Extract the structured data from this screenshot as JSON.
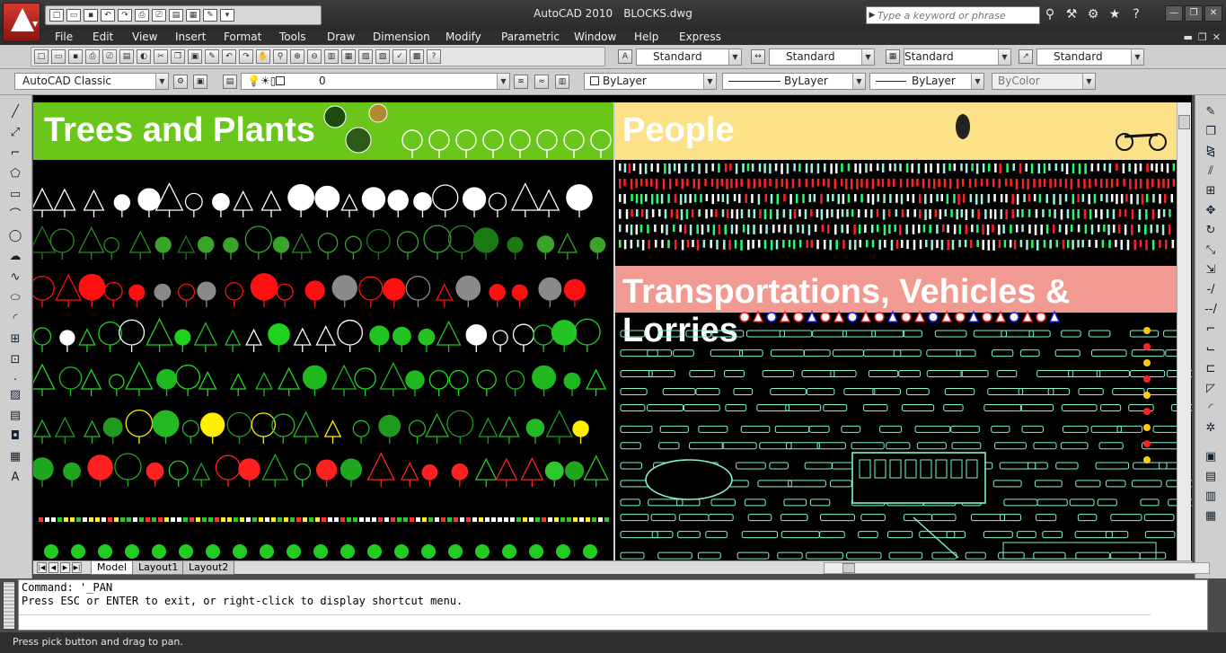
{
  "app": {
    "name": "AutoCAD 2010",
    "document": "BLOCKS.dwg"
  },
  "search": {
    "placeholder": "Type a keyword or phrase"
  },
  "menus": [
    "File",
    "Edit",
    "View",
    "Insert",
    "Format",
    "Tools",
    "Draw",
    "Dimension",
    "Modify",
    "Parametric",
    "Window",
    "Help",
    "Express"
  ],
  "toolbar": {
    "text_style": "Standard",
    "dim_style": "Standard",
    "table_style": "Standard",
    "mleader_style": "Standard",
    "workspace": "AutoCAD Classic",
    "layer": "0",
    "color": "ByLayer",
    "linetype": "ByLayer",
    "lineweight": "ByLayer",
    "plot_style": "ByColor"
  },
  "canvas": {
    "trees_title": "Trees and Plants",
    "people_title": "People",
    "transport_title": "Transportations, Vehicles & Lorries",
    "trees_bg": "#6ac61a",
    "people_bg": "#fde188",
    "transport_bg": "#f19a92"
  },
  "layout_tabs": [
    "Model",
    "Layout1",
    "Layout2"
  ],
  "command": {
    "line1": "Command: '_PAN",
    "line2": "Press ESC or ENTER to exit, or right-click to display shortcut menu."
  },
  "status_text": "Press pick button and drag to pan."
}
